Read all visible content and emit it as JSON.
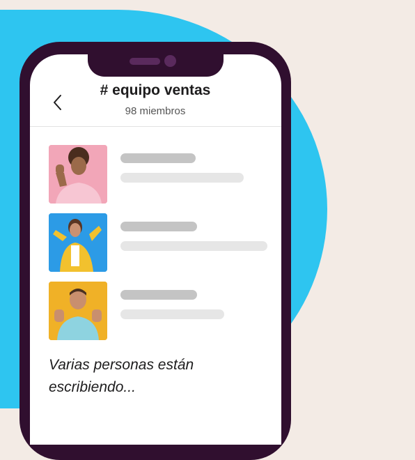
{
  "channel": {
    "title": "# equipo ventas",
    "members": "98 miembros"
  },
  "members_list": [
    {
      "avatar": "waving-woman-photo",
      "bg": "#f2a6b8"
    },
    {
      "avatar": "cheering-woman-photo",
      "bg": "#2c9be6"
    },
    {
      "avatar": "thumbs-up-man-photo",
      "bg": "#f0b127"
    }
  ],
  "typing_indicator": "Varias personas están escribiendo...",
  "colors": {
    "background": "#f3ebe5",
    "accent": "#2ec5f0",
    "phone_frame": "#300f2f"
  }
}
